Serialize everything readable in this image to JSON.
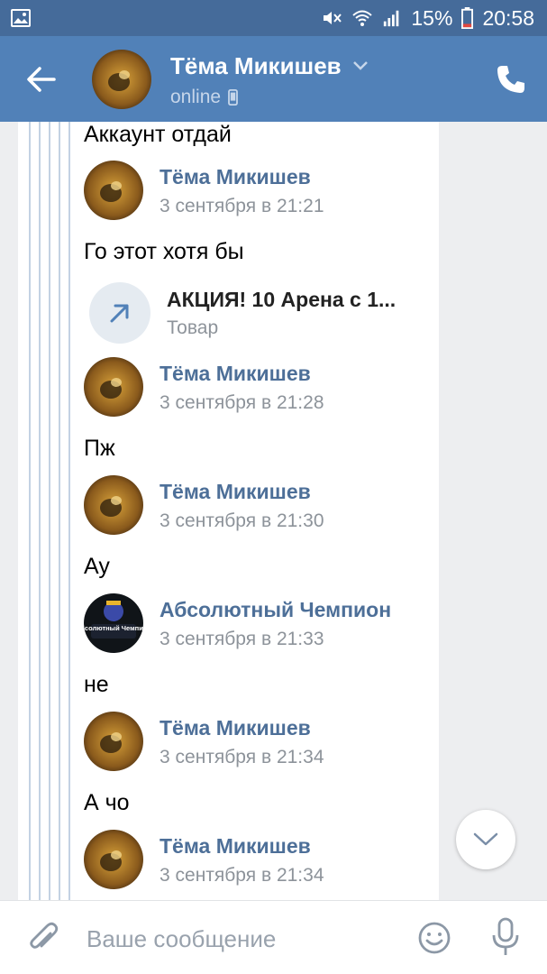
{
  "status_bar": {
    "battery": "15%",
    "time": "20:58",
    "icons": [
      "image-icon",
      "mute-icon",
      "wifi-icon",
      "signal-icon",
      "battery-icon"
    ]
  },
  "header": {
    "name": "Тёма Микишев",
    "status": "online",
    "icons": [
      "back-arrow-icon",
      "chevron-down-icon",
      "mobile-icon",
      "phone-icon"
    ]
  },
  "messages": [
    {
      "type": "text",
      "text": "Аккаунт отдай"
    },
    {
      "type": "author",
      "name": "Тёма Микишев",
      "time": "3 сентября в 21:21"
    },
    {
      "type": "text",
      "text": "Го этот хотя бы"
    },
    {
      "type": "link",
      "title": "АКЦИЯ! 10 Арена с 1...",
      "subtitle": "Товар"
    },
    {
      "type": "author",
      "name": "Тёма Микишев",
      "time": "3 сентября в 21:28"
    },
    {
      "type": "text",
      "text": "Пж"
    },
    {
      "type": "author",
      "name": "Тёма Микишев",
      "time": "3 сентября в 21:30"
    },
    {
      "type": "text",
      "text": "Ау"
    },
    {
      "type": "author",
      "name": "Абсолютный Чемпион",
      "time": "3 сентября в 21:33",
      "avatar_text": "Абсолютный Чемпион"
    },
    {
      "type": "text",
      "text": "не"
    },
    {
      "type": "author",
      "name": "Тёма Микишев",
      "time": "3 сентября в 21:34"
    },
    {
      "type": "text",
      "text": "А чо"
    },
    {
      "type": "author",
      "name": "Тёма Микишев",
      "time": "3 сентября в 21:34"
    }
  ],
  "input": {
    "placeholder": "Ваше сообщение",
    "value": "",
    "icons": [
      "paperclip-icon",
      "emoji-icon",
      "microphone-icon"
    ]
  },
  "colors": {
    "status_bar": "#456b9a",
    "header": "#5181b8",
    "author_name": "#4d6f98",
    "time": "#8d939a",
    "forward_line": "#c3d2e3",
    "chat_bg": "#edeef0"
  }
}
